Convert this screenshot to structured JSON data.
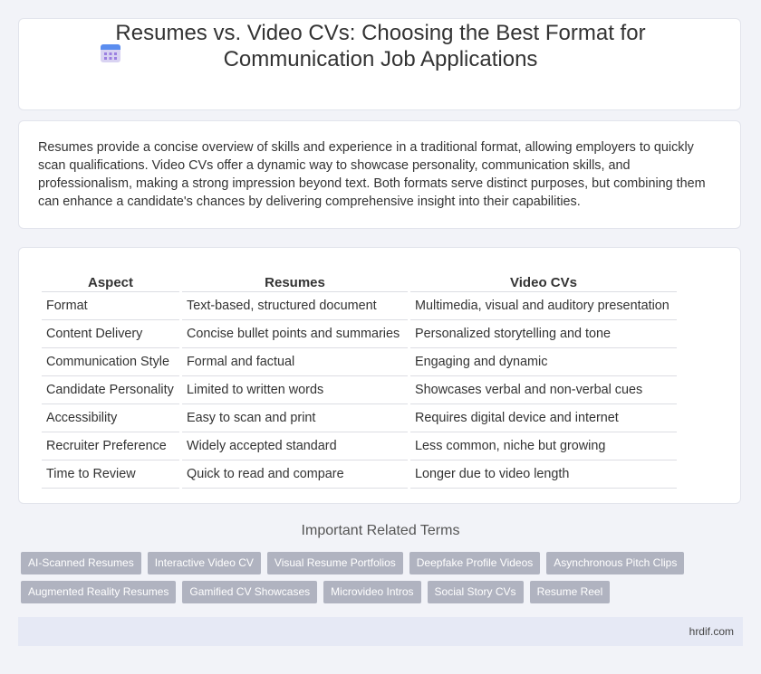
{
  "header": {
    "title_line1": "Resumes vs. Video CVs: Choosing the Best Format for",
    "title_line2": "Communication Job Applications",
    "icon": "calendar-icon"
  },
  "intro": "Resumes provide a concise overview of skills and experience in a traditional format, allowing employers to quickly scan qualifications. Video CVs offer a dynamic way to showcase personality, communication skills, and professionalism, making a strong impression beyond text. Both formats serve distinct purposes, but combining them can enhance a candidate's chances by delivering comprehensive insight into their capabilities.",
  "table": {
    "headers": [
      "Aspect",
      "Resumes",
      "Video CVs"
    ],
    "rows": [
      [
        "Format",
        "Text-based, structured document",
        "Multimedia, visual and auditory presentation"
      ],
      [
        "Content Delivery",
        "Concise bullet points and summaries",
        "Personalized storytelling and tone"
      ],
      [
        "Communication Style",
        "Formal and factual",
        "Engaging and dynamic"
      ],
      [
        "Candidate Personality",
        "Limited to written words",
        "Showcases verbal and non-verbal cues"
      ],
      [
        "Accessibility",
        "Easy to scan and print",
        "Requires digital device and internet"
      ],
      [
        "Recruiter Preference",
        "Widely accepted standard",
        "Less common, niche but growing"
      ],
      [
        "Time to Review",
        "Quick to read and compare",
        "Longer due to video length"
      ]
    ]
  },
  "related": {
    "title": "Important Related Terms",
    "row1": [
      "AI-Scanned Resumes",
      "Interactive Video CV",
      "Visual Resume Portfolios",
      "Deepfake Profile Videos",
      "Asynchronous Pitch Clips"
    ],
    "row2": [
      "Augmented Reality Resumes",
      "Gamified CV Showcases",
      "Microvideo Intros",
      "Social Story CVs",
      "Resume Reel"
    ]
  },
  "footer": {
    "site": "hrdif.com"
  },
  "colors": {
    "tag_bg": "#b0b3c0",
    "page_bg": "#f2f3f8",
    "footer_bg": "#e6e9f5"
  }
}
